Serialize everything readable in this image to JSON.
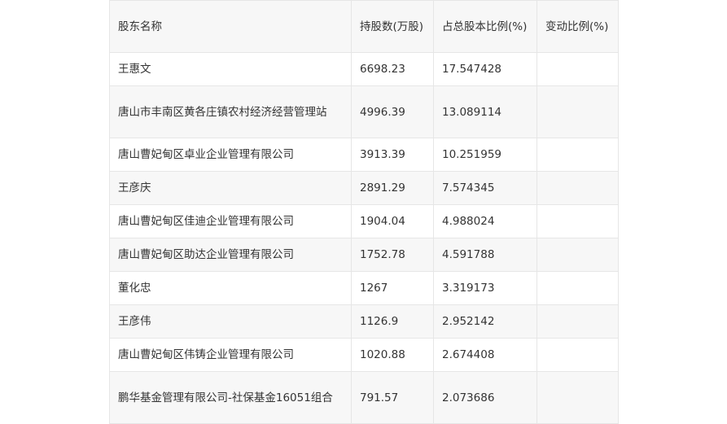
{
  "table": {
    "headers": [
      "股东名称",
      "持股数(万股)",
      "占总股本比例(%)",
      "变动比例(%)"
    ],
    "rows": [
      {
        "name": "王惠文",
        "shares": "6698.23",
        "ratio": "17.547428",
        "change": ""
      },
      {
        "name": "唐山市丰南区黄各庄镇农村经济经营管理站",
        "shares": "4996.39",
        "ratio": "13.089114",
        "change": ""
      },
      {
        "name": "唐山曹妃甸区卓业企业管理有限公司",
        "shares": "3913.39",
        "ratio": "10.251959",
        "change": ""
      },
      {
        "name": "王彦庆",
        "shares": "2891.29",
        "ratio": "7.574345",
        "change": ""
      },
      {
        "name": "唐山曹妃甸区佳迪企业管理有限公司",
        "shares": "1904.04",
        "ratio": "4.988024",
        "change": ""
      },
      {
        "name": "唐山曹妃甸区助达企业管理有限公司",
        "shares": "1752.78",
        "ratio": "4.591788",
        "change": ""
      },
      {
        "name": "董化忠",
        "shares": "1267",
        "ratio": "3.319173",
        "change": ""
      },
      {
        "name": "王彦伟",
        "shares": "1126.9",
        "ratio": "2.952142",
        "change": ""
      },
      {
        "name": "唐山曹妃甸区伟铸企业管理有限公司",
        "shares": "1020.88",
        "ratio": "2.674408",
        "change": ""
      },
      {
        "name": "鹏华基金管理有限公司-社保基金16051组合",
        "shares": "791.57",
        "ratio": "2.073686",
        "change": ""
      }
    ]
  }
}
